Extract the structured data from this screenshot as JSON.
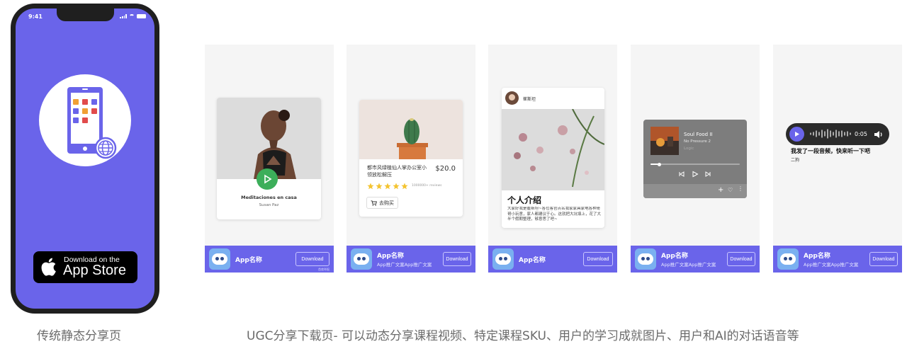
{
  "phone": {
    "status_time": "9:41",
    "badge_line1": "Download on the",
    "badge_line2": "App Store"
  },
  "captions": {
    "left": "传统静态分享页",
    "right": "UGC分享下载页- 可以动态分享课程视频、特定课程SKU、用户的学习成就图片、用户和AI的对话语音等"
  },
  "footer": {
    "app_name": "App名称",
    "app_desc": "App推广文案App推广文案",
    "download_label": "Download",
    "note": "首席举报"
  },
  "cards": {
    "video": {
      "title": "Meditaciones en casa",
      "author": "Susan Paz"
    },
    "sku": {
      "product": "都市风绿植仙人掌办公室小领放松解压",
      "price": "$20.0",
      "reviews": "1000000+ reviews",
      "rating": 5,
      "buy_label": "去购买"
    },
    "photo": {
      "username": "崔斯坦",
      "title": "个人介绍",
      "body": "大家好我是崔斯坦~各位客官点名我家家具家电各种哥哥小玩意，家人都建议于心。这就把大坑填上，花了大半个假期整理，够意思了吧~"
    },
    "music": {
      "track": "Soul Food II",
      "album": "No Pressure 2",
      "artist": "Logic",
      "progress": 0.1
    },
    "voice": {
      "duration": "0:05",
      "message": "我发了一段音频，快来听一下吧",
      "user": "二狗"
    }
  },
  "colors": {
    "brand": "#6a64ea",
    "card_bg": "#f5f5f5",
    "play_green": "#3cae5a",
    "star": "#f4c431"
  }
}
